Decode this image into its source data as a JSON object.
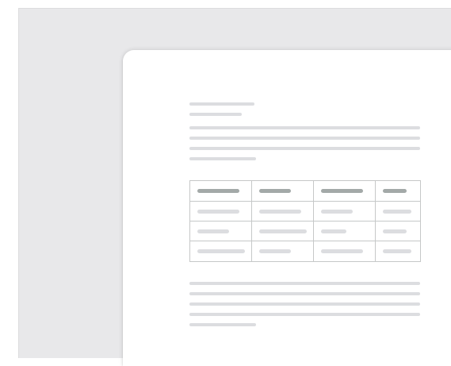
{
  "colors": {
    "background": "#e8e8ea",
    "page": "#ffffff",
    "text_placeholder": "#dcdde0",
    "header_placeholder": "#a3a9a8",
    "table_border": "#c6c8c8"
  },
  "document": {
    "title_placeholder_lines": 2,
    "intro_placeholder_lines": 4,
    "closing_placeholder_lines": 5,
    "table": {
      "columns": 4,
      "header_rows": 1,
      "body_rows": 3
    }
  }
}
